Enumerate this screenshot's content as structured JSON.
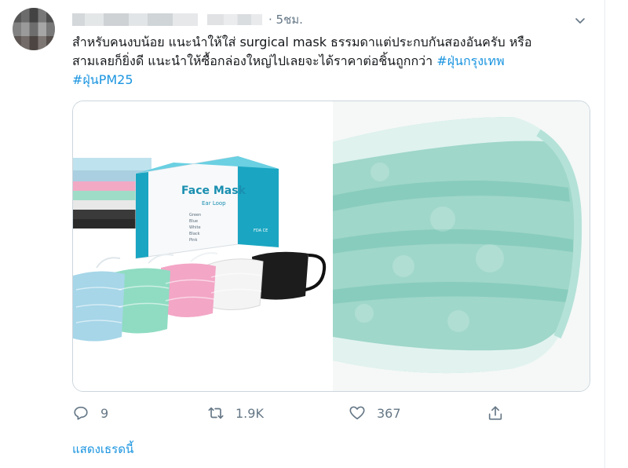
{
  "tweet": {
    "time": "· 5ชม.",
    "text_lines": [
      "สำหรับคนงบน้อย แนะนำให้ใส่ surgical mask ธรรมดาแต่ประกบกันสองอันครับ หรือ",
      "สามเลยก็ยิ่งดี แนะนำให้ซื้อกล่องใหญ่ไปเลยจะได้ราคาต่อชิ้นถูกกว่า "
    ],
    "hashtags": [
      "#ฝุ่นกรุงเทพ",
      "#ฝุ่นPM25"
    ]
  },
  "media": {
    "box_brand": "Face Mask",
    "box_subtitle": "Ear Loop",
    "box_colors": [
      "Green",
      "Blue",
      "White",
      "Black",
      "Pink"
    ],
    "box_badge": "FDA CE"
  },
  "actions": {
    "reply_count": "9",
    "retweet_count": "1.9K",
    "like_count": "367"
  },
  "show_thread_label": "แสดงเธรดนี้",
  "colors": {
    "accent": "#1b95e0",
    "muted": "#657786",
    "text": "#14171a",
    "border": "#ccd6dd"
  }
}
